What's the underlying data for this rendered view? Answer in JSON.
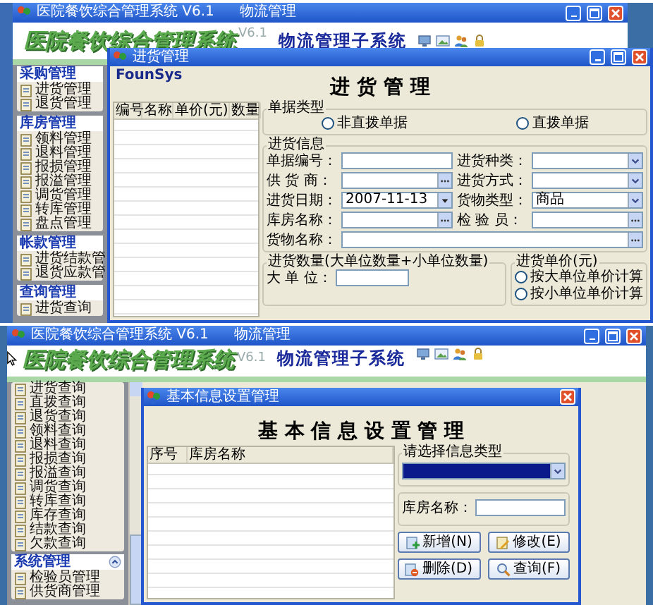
{
  "top_screen": {
    "window": {
      "title": "医院餐饮综合管理系统 V6.1",
      "subtitle": "物流管理"
    },
    "banner": {
      "logo": "医院餐饮综合管理系统",
      "version": "V6.1",
      "subsystem": "物流管理子系统"
    },
    "sidebar": {
      "groups": [
        {
          "title": "采购管理",
          "items": [
            "进货管理",
            "退货管理"
          ]
        },
        {
          "title": "库房管理",
          "items": [
            "领料管理",
            "退料管理",
            "报损管理",
            "报溢管理",
            "调货管理",
            "转库管理",
            "盘点管理"
          ]
        },
        {
          "title": "帐款管理",
          "items": [
            "进货结款管",
            "退货应款管"
          ]
        },
        {
          "title": "查询管理",
          "items": [
            "进货查询"
          ]
        }
      ]
    },
    "dialog": {
      "title": "进货管理",
      "brand": "FounSys",
      "heading": "进 货 管 理",
      "table": {
        "columns": [
          "编号",
          "名称",
          "单价(元)",
          "数量"
        ]
      },
      "doc_type": {
        "legend": "单据类型",
        "options": [
          {
            "label": "非直拨单据",
            "selected": false
          },
          {
            "label": "直拨单据",
            "selected": false
          }
        ]
      },
      "info": {
        "legend": "进货信息",
        "fields": [
          {
            "label": "单据编号：",
            "kind": "text"
          },
          {
            "label": "进货种类：",
            "kind": "select"
          },
          {
            "label": "供 货 商：",
            "kind": "lookup"
          },
          {
            "label": "进货方式：",
            "kind": "select"
          },
          {
            "label": "进货日期：",
            "kind": "date",
            "value": "2007-11-13"
          },
          {
            "label": "货物类型：",
            "kind": "select",
            "value": "商品"
          },
          {
            "label": "库房名称：",
            "kind": "lookup"
          },
          {
            "label": "检 验 员：",
            "kind": "lookup"
          },
          {
            "label": "货物名称：",
            "kind": "lookup",
            "wide": true
          }
        ]
      },
      "quantity": {
        "legend": "进货数量(大单位数量+小单位数量)",
        "fields": [
          {
            "label": "大 单 位：",
            "kind": "text"
          }
        ]
      },
      "price": {
        "legend": "进货单价(元)",
        "options": [
          {
            "label": "按大单位单价计算",
            "selected": false
          },
          {
            "label": "按小单位单价计算",
            "selected": false
          }
        ]
      }
    }
  },
  "bottom_screen": {
    "window": {
      "title": "医院餐饮综合管理系统 V6.1",
      "subtitle": "物流管理"
    },
    "banner": {
      "logo": "医院餐饮综合管理系统",
      "version": "V6.1",
      "subsystem": "物流管理子系统"
    },
    "sidebar": {
      "groups": [
        {
          "items": [
            "进货查询",
            "直拨查询",
            "退货查询",
            "领料查询",
            "退料查询",
            "报损查询",
            "报溢查询",
            "调货查询",
            "转库查询",
            "库存查询",
            "结款查询",
            "欠款查询"
          ]
        },
        {
          "title": "系统管理",
          "collapse_button": true,
          "items": [
            "检验员管理",
            "供货商管理"
          ]
        }
      ]
    },
    "dialog": {
      "title": "基本信息设置管理",
      "heading": "基 本 信 息 设 置 管 理",
      "table": {
        "columns": [
          "序号",
          "库房名称"
        ]
      },
      "type_group": {
        "legend": "请选择信息类型",
        "highlighted": true
      },
      "name_field": {
        "label": "库房名称："
      },
      "actions": [
        {
          "label": "新增(N)",
          "kind": "add"
        },
        {
          "label": "修改(E)",
          "kind": "edit"
        },
        {
          "label": "删除(D)",
          "kind": "delete"
        },
        {
          "label": "查询(F)",
          "kind": "search"
        }
      ]
    }
  }
}
